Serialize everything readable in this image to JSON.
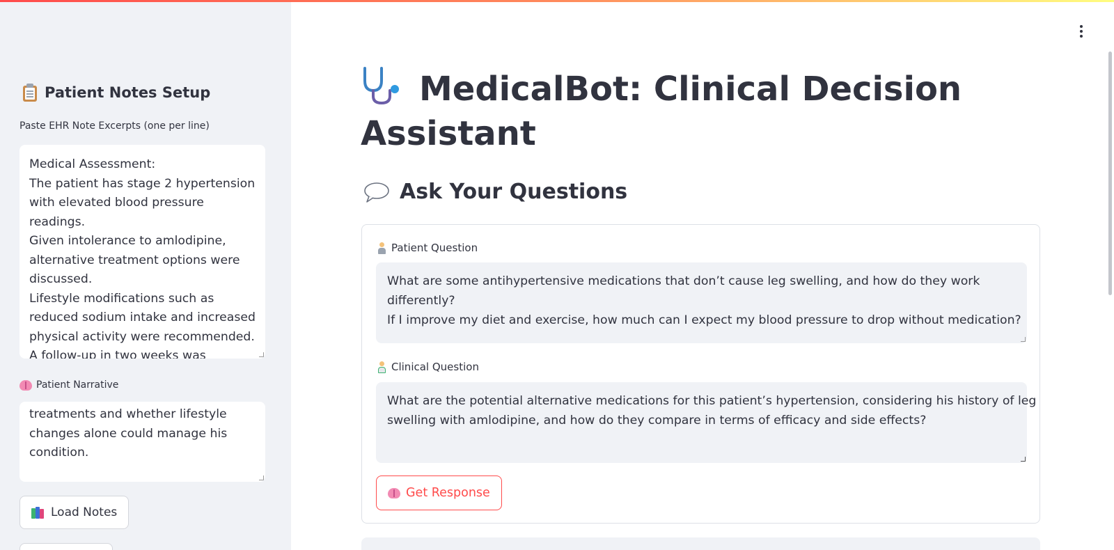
{
  "sidebar": {
    "header": "Patient Notes Setup",
    "ehr_label": "Paste EHR Note Excerpts (one per line)",
    "ehr_lines": [
      "Medical Assessment:",
      "The patient has stage 2 hypertension",
      "with elevated blood pressure",
      "readings.",
      "Given intolerance to amlodipine,",
      "alternative treatment options were",
      "discussed.",
      "Lifestyle modifications such as",
      "reduced sodium intake and increased",
      "physical activity were recommended.",
      "A follow-up in two weeks was"
    ],
    "narrative_label": "Patient Narrative",
    "narrative_lines": [
      "treatments and whether lifestyle",
      "changes alone could manage his",
      "condition."
    ],
    "load_notes_label": "Load Notes"
  },
  "main": {
    "title": "MedicalBot: Clinical Decision Assistant",
    "section_heading": "Ask Your Questions",
    "patient_question_label": "Patient Question",
    "patient_question_lines": [
      "What are some antihypertensive medications that don’t cause leg swelling, and how do they work",
      "differently?",
      "If I improve my diet and exercise, how much can I expect my blood pressure to drop without medication?"
    ],
    "clinical_question_label": "Clinical Question",
    "clinical_question_lines": [
      "What are the potential alternative medications for this patient’s hypertension, considering his history of leg",
      "swelling with amlodipine, and how do they compare in terms of efficacy and side effects?"
    ],
    "get_response_label": "Get Response"
  },
  "colors": {
    "accent": "#ff4b4b",
    "sidebar_bg": "#f0f2f6",
    "text": "#31333f"
  }
}
